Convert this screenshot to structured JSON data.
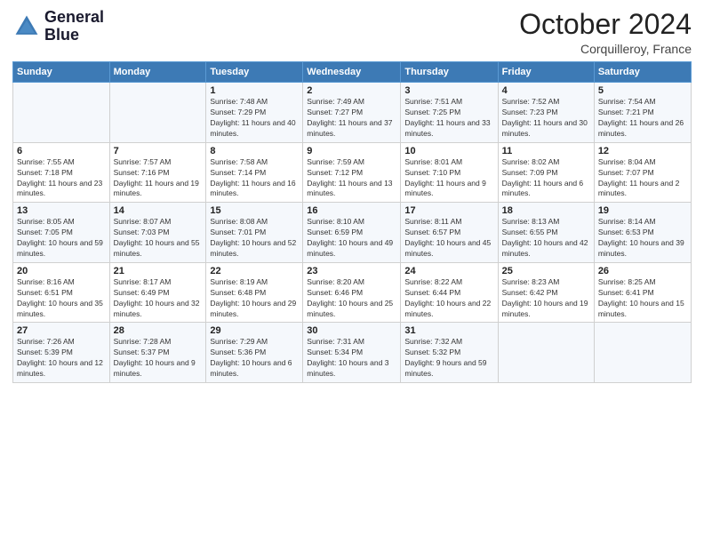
{
  "header": {
    "logo_line1": "General",
    "logo_line2": "Blue",
    "month_year": "October 2024",
    "location": "Corquilleroy, France"
  },
  "days_of_week": [
    "Sunday",
    "Monday",
    "Tuesday",
    "Wednesday",
    "Thursday",
    "Friday",
    "Saturday"
  ],
  "weeks": [
    [
      {
        "day": "",
        "info": ""
      },
      {
        "day": "",
        "info": ""
      },
      {
        "day": "1",
        "info": "Sunrise: 7:48 AM\nSunset: 7:29 PM\nDaylight: 11 hours and 40 minutes."
      },
      {
        "day": "2",
        "info": "Sunrise: 7:49 AM\nSunset: 7:27 PM\nDaylight: 11 hours and 37 minutes."
      },
      {
        "day": "3",
        "info": "Sunrise: 7:51 AM\nSunset: 7:25 PM\nDaylight: 11 hours and 33 minutes."
      },
      {
        "day": "4",
        "info": "Sunrise: 7:52 AM\nSunset: 7:23 PM\nDaylight: 11 hours and 30 minutes."
      },
      {
        "day": "5",
        "info": "Sunrise: 7:54 AM\nSunset: 7:21 PM\nDaylight: 11 hours and 26 minutes."
      }
    ],
    [
      {
        "day": "6",
        "info": "Sunrise: 7:55 AM\nSunset: 7:18 PM\nDaylight: 11 hours and 23 minutes."
      },
      {
        "day": "7",
        "info": "Sunrise: 7:57 AM\nSunset: 7:16 PM\nDaylight: 11 hours and 19 minutes."
      },
      {
        "day": "8",
        "info": "Sunrise: 7:58 AM\nSunset: 7:14 PM\nDaylight: 11 hours and 16 minutes."
      },
      {
        "day": "9",
        "info": "Sunrise: 7:59 AM\nSunset: 7:12 PM\nDaylight: 11 hours and 13 minutes."
      },
      {
        "day": "10",
        "info": "Sunrise: 8:01 AM\nSunset: 7:10 PM\nDaylight: 11 hours and 9 minutes."
      },
      {
        "day": "11",
        "info": "Sunrise: 8:02 AM\nSunset: 7:09 PM\nDaylight: 11 hours and 6 minutes."
      },
      {
        "day": "12",
        "info": "Sunrise: 8:04 AM\nSunset: 7:07 PM\nDaylight: 11 hours and 2 minutes."
      }
    ],
    [
      {
        "day": "13",
        "info": "Sunrise: 8:05 AM\nSunset: 7:05 PM\nDaylight: 10 hours and 59 minutes."
      },
      {
        "day": "14",
        "info": "Sunrise: 8:07 AM\nSunset: 7:03 PM\nDaylight: 10 hours and 55 minutes."
      },
      {
        "day": "15",
        "info": "Sunrise: 8:08 AM\nSunset: 7:01 PM\nDaylight: 10 hours and 52 minutes."
      },
      {
        "day": "16",
        "info": "Sunrise: 8:10 AM\nSunset: 6:59 PM\nDaylight: 10 hours and 49 minutes."
      },
      {
        "day": "17",
        "info": "Sunrise: 8:11 AM\nSunset: 6:57 PM\nDaylight: 10 hours and 45 minutes."
      },
      {
        "day": "18",
        "info": "Sunrise: 8:13 AM\nSunset: 6:55 PM\nDaylight: 10 hours and 42 minutes."
      },
      {
        "day": "19",
        "info": "Sunrise: 8:14 AM\nSunset: 6:53 PM\nDaylight: 10 hours and 39 minutes."
      }
    ],
    [
      {
        "day": "20",
        "info": "Sunrise: 8:16 AM\nSunset: 6:51 PM\nDaylight: 10 hours and 35 minutes."
      },
      {
        "day": "21",
        "info": "Sunrise: 8:17 AM\nSunset: 6:49 PM\nDaylight: 10 hours and 32 minutes."
      },
      {
        "day": "22",
        "info": "Sunrise: 8:19 AM\nSunset: 6:48 PM\nDaylight: 10 hours and 29 minutes."
      },
      {
        "day": "23",
        "info": "Sunrise: 8:20 AM\nSunset: 6:46 PM\nDaylight: 10 hours and 25 minutes."
      },
      {
        "day": "24",
        "info": "Sunrise: 8:22 AM\nSunset: 6:44 PM\nDaylight: 10 hours and 22 minutes."
      },
      {
        "day": "25",
        "info": "Sunrise: 8:23 AM\nSunset: 6:42 PM\nDaylight: 10 hours and 19 minutes."
      },
      {
        "day": "26",
        "info": "Sunrise: 8:25 AM\nSunset: 6:41 PM\nDaylight: 10 hours and 15 minutes."
      }
    ],
    [
      {
        "day": "27",
        "info": "Sunrise: 7:26 AM\nSunset: 5:39 PM\nDaylight: 10 hours and 12 minutes."
      },
      {
        "day": "28",
        "info": "Sunrise: 7:28 AM\nSunset: 5:37 PM\nDaylight: 10 hours and 9 minutes."
      },
      {
        "day": "29",
        "info": "Sunrise: 7:29 AM\nSunset: 5:36 PM\nDaylight: 10 hours and 6 minutes."
      },
      {
        "day": "30",
        "info": "Sunrise: 7:31 AM\nSunset: 5:34 PM\nDaylight: 10 hours and 3 minutes."
      },
      {
        "day": "31",
        "info": "Sunrise: 7:32 AM\nSunset: 5:32 PM\nDaylight: 9 hours and 59 minutes."
      },
      {
        "day": "",
        "info": ""
      },
      {
        "day": "",
        "info": ""
      }
    ]
  ]
}
